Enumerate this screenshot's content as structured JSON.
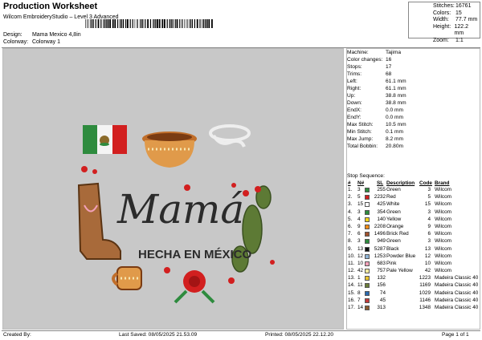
{
  "header": {
    "title": "Production Worksheet",
    "software": "Wilcom EmbroideryStudio – Level 3 Advanced",
    "design_label": "Design:",
    "design_value": "Mama Mexico 4,8in",
    "colorway_label": "Colorway:",
    "colorway_value": "Colorway 1"
  },
  "stats": [
    {
      "k": "Stitches:",
      "v": "16761"
    },
    {
      "k": "Colors:",
      "v": "15"
    },
    {
      "k": "Width:",
      "v": "77.7 mm"
    },
    {
      "k": "Height:",
      "v": "122.2 mm"
    },
    {
      "k": "Zoom:",
      "v": "1:1"
    }
  ],
  "design_art": {
    "main_text": "Mamá",
    "sub_text": "HECHA EN MÉXICO"
  },
  "machine_info": [
    {
      "k": "Machine:",
      "v": "Tajima"
    },
    {
      "k": "Color changes:",
      "v": "16"
    },
    {
      "k": "Stops:",
      "v": "17"
    },
    {
      "k": "Trims:",
      "v": "68"
    },
    {
      "k": "Left:",
      "v": "61.1 mm"
    },
    {
      "k": "Right:",
      "v": "61.1 mm"
    },
    {
      "k": "Up:",
      "v": "38.8 mm"
    },
    {
      "k": "Down:",
      "v": "38.8 mm"
    },
    {
      "k": "EndX:",
      "v": "0.0 mm"
    },
    {
      "k": "EndY:",
      "v": "0.0 mm"
    },
    {
      "k": "Max Stitch:",
      "v": "10.5 mm"
    },
    {
      "k": "Min Stitch:",
      "v": "0.1 mm"
    },
    {
      "k": "Max Jump:",
      "v": "8.2 mm"
    },
    {
      "k": "Total Bobbin:",
      "v": "20.80m"
    }
  ],
  "stop_sequence": {
    "title": "Stop Sequence:",
    "headers": [
      "#",
      "N#",
      "SL",
      "Description",
      "Code",
      "Brand"
    ],
    "rows": [
      {
        "idx": "1.",
        "n": "3",
        "color": "#2e8b3e",
        "sl": "255",
        "desc": "Green",
        "code": "3",
        "brand": "Wilcom"
      },
      {
        "idx": "2.",
        "n": "5",
        "color": "#d21f1f",
        "sl": "2232",
        "desc": "Red",
        "code": "5",
        "brand": "Wilcom"
      },
      {
        "idx": "3.",
        "n": "15",
        "color": "#ffffff",
        "sl": "425",
        "desc": "White",
        "code": "15",
        "brand": "Wilcom"
      },
      {
        "idx": "4.",
        "n": "3",
        "color": "#2e8b3e",
        "sl": "354",
        "desc": "Green",
        "code": "3",
        "brand": "Wilcom"
      },
      {
        "idx": "5.",
        "n": "4",
        "color": "#f2d21a",
        "sl": "140",
        "desc": "Yellow",
        "code": "4",
        "brand": "Wilcom"
      },
      {
        "idx": "6.",
        "n": "9",
        "color": "#f08a16",
        "sl": "2208",
        "desc": "Orange",
        "code": "9",
        "brand": "Wilcom"
      },
      {
        "idx": "7.",
        "n": "6",
        "color": "#a0522d",
        "sl": "1496",
        "desc": "Brick Red",
        "code": "6",
        "brand": "Wilcom"
      },
      {
        "idx": "8.",
        "n": "3",
        "color": "#2e8b3e",
        "sl": "949",
        "desc": "Green",
        "code": "3",
        "brand": "Wilcom"
      },
      {
        "idx": "9.",
        "n": "13",
        "color": "#111111",
        "sl": "5287",
        "desc": "Black",
        "code": "13",
        "brand": "Wilcom"
      },
      {
        "idx": "10.",
        "n": "12",
        "color": "#8fb4d6",
        "sl": "1253",
        "desc": "Powder Blue",
        "code": "12",
        "brand": "Wilcom"
      },
      {
        "idx": "11.",
        "n": "10",
        "color": "#f2a0b8",
        "sl": "683",
        "desc": "Pink",
        "code": "10",
        "brand": "Wilcom"
      },
      {
        "idx": "12.",
        "n": "42",
        "color": "#f5eaa0",
        "sl": "757",
        "desc": "Pale Yellow",
        "code": "42",
        "brand": "Wilcom"
      },
      {
        "idx": "13.",
        "n": "1",
        "color": "#e8c22e",
        "sl": "132",
        "desc": "",
        "code": "1223",
        "brand": "Madeira Classic 40"
      },
      {
        "idx": "14.",
        "n": "11",
        "color": "#6b7d3a",
        "sl": "156",
        "desc": "",
        "code": "1169",
        "brand": "Madeira Classic 40"
      },
      {
        "idx": "15.",
        "n": "8",
        "color": "#2a6ab0",
        "sl": "74",
        "desc": "",
        "code": "1029",
        "brand": "Madeira Classic 40"
      },
      {
        "idx": "16.",
        "n": "7",
        "color": "#c43a3a",
        "sl": "45",
        "desc": "",
        "code": "1146",
        "brand": "Madeira Classic 40"
      },
      {
        "idx": "17.",
        "n": "14",
        "color": "#8a5a2e",
        "sl": "313",
        "desc": "",
        "code": "1348",
        "brand": "Madeira Classic 40"
      }
    ]
  },
  "footer": {
    "created_by": "Created By:",
    "last_saved": "Last Saved: 08/05/2025 21.53.09",
    "printed": "Printed: 08/05/2025 22.12.20",
    "page": "Page 1 of 1"
  }
}
